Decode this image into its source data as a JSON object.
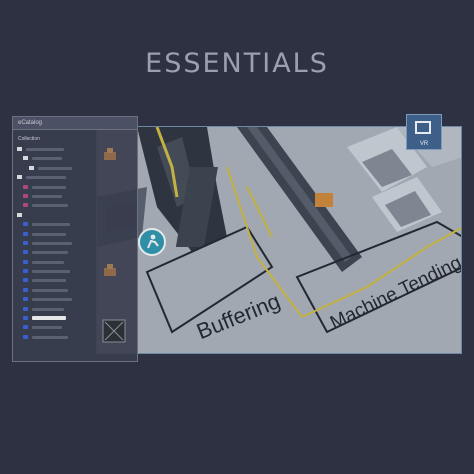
{
  "page": {
    "title": "ESSENTIALS"
  },
  "catalog": {
    "title": "eCatalog",
    "subtitle": "Collection",
    "items": [
      {
        "kind": "folder",
        "indent": 0,
        "w": 38
      },
      {
        "kind": "folder",
        "indent": 6,
        "w": 30
      },
      {
        "kind": "folder",
        "indent": 12,
        "w": 34
      },
      {
        "kind": "folder",
        "indent": 0,
        "w": 40
      },
      {
        "kind": "pink",
        "indent": 6,
        "w": 34
      },
      {
        "kind": "pink",
        "indent": 6,
        "w": 30
      },
      {
        "kind": "pink",
        "indent": 6,
        "w": 36
      },
      {
        "kind": "folder",
        "indent": 0,
        "w": 0
      },
      {
        "kind": "blue",
        "indent": 6,
        "w": 38
      },
      {
        "kind": "blue",
        "indent": 6,
        "w": 34
      },
      {
        "kind": "blue",
        "indent": 6,
        "w": 40
      },
      {
        "kind": "blue",
        "indent": 6,
        "w": 36
      },
      {
        "kind": "blue",
        "indent": 6,
        "w": 32
      },
      {
        "kind": "blue",
        "indent": 6,
        "w": 38
      },
      {
        "kind": "blue",
        "indent": 6,
        "w": 34
      },
      {
        "kind": "blue",
        "indent": 6,
        "w": 36
      },
      {
        "kind": "blue",
        "indent": 6,
        "w": 40
      },
      {
        "kind": "blue",
        "indent": 6,
        "w": 32
      },
      {
        "kind": "blue",
        "indent": 6,
        "w": 34,
        "selected": true
      },
      {
        "kind": "blue",
        "indent": 6,
        "w": 30
      },
      {
        "kind": "blue",
        "indent": 6,
        "w": 36
      }
    ]
  },
  "scene": {
    "zone_labels": {
      "buffering": "Buffering",
      "machine_tending": "Machine Tending"
    }
  },
  "vr_badge": {
    "label": "VR"
  },
  "colors": {
    "background": "#2e3142",
    "accent_blue": "#3e5f88",
    "teal": "#2f8fa6",
    "safety_yellow": "#e0c534",
    "conveyor_orange": "#e08a2a"
  },
  "icons": [
    "folder-icon",
    "vr-headset-icon",
    "teleport-icon",
    "robot-icon"
  ]
}
